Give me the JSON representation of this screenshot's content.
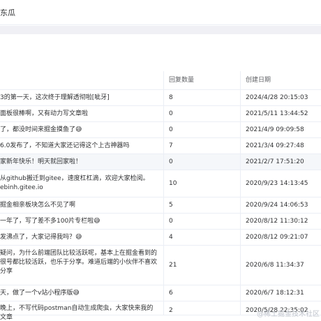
{
  "header": {
    "brand": "东瓜"
  },
  "table": {
    "columns": [
      "",
      "回复数量",
      "创建日期"
    ],
    "rows": [
      {
        "title": "3的第一天，这次终于理解透彻啦[呲牙]",
        "replies": "8",
        "date": "2024/4/28 20:15:03"
      },
      {
        "title": "面板很棒啊，又有动力写文章啦",
        "replies": "0",
        "date": "2021/5/11 13:44:52"
      },
      {
        "title": "了，都没时间来掘金摸鱼了😅",
        "replies": "0",
        "date": "2021/4/9 09:09:58"
      },
      {
        "title": "6.0发布了，不知道大家还记得这个上古神器吗",
        "replies": "7",
        "date": "2021/3/4 09:27:48"
      },
      {
        "title": "家新年快乐！明天就回家啦！",
        "replies": "0",
        "date": "2021/2/7 17:51:20"
      },
      {
        "title": "从github搬迁到gitee，速度杠杠滴，欢迎大家检阅。 ebinh.gitee.io",
        "replies": "10",
        "date": "2020/9/23 14:13:45"
      },
      {
        "title": "掘金相亲板块怎么不见了啊",
        "replies": "5",
        "date": "2020/9/24 14:06:53"
      },
      {
        "title": "一年了，写了差不多100片专栏啦😅",
        "replies": "0",
        "date": "2020/8/12 11:30:12"
      },
      {
        "title": "发沸点了，大家记得我吗？😅",
        "replies": "4",
        "date": "2020/8/12 09:21:07"
      },
      {
        "title": "疑问，为什么前端团队比较活跃呢，基本上在掘金看到的很号都比较活跃，也乐于分享。难道后端的小伙伴不喜欢分享",
        "replies": "21",
        "date": "2020/6/8 11:34:37"
      },
      {
        "title": "天，做了一个v站小程序版😅",
        "replies": "6",
        "date": "2020/6/7 18:12:31"
      },
      {
        "title": "晚上，不写代码postman自动生成爬虫，大家快来我的文章",
        "replies": "2",
        "date": "2020/5/28 22:35:02"
      }
    ]
  },
  "watermark": "@稀土掘金技术社区"
}
